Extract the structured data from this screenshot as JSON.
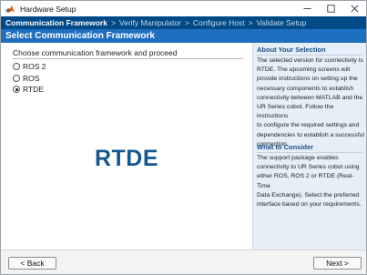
{
  "window": {
    "title": "Hardware Setup",
    "icon": "matlab-logo-icon",
    "controls": [
      "minimize-icon",
      "maximize-icon",
      "close-icon"
    ]
  },
  "breadcrumb": {
    "steps": [
      "Communication Framework",
      "Verify Manipulator",
      "Configure Host",
      "Validate Setup"
    ],
    "active_index": 0,
    "separator": ">"
  },
  "page": {
    "title": "Select Communication Framework"
  },
  "main": {
    "instruction": "Choose communication framework and proceed",
    "options": [
      {
        "label": "ROS 2",
        "checked": false
      },
      {
        "label": "ROS",
        "checked": false
      },
      {
        "label": "RTDE",
        "checked": true
      }
    ],
    "selected_display": "RTDE"
  },
  "side": {
    "about_heading": "About Your Selection",
    "about_lines": [
      "The selected version for connectivity is",
      "RTDE. The upcoming screens will",
      "provide instructions on setting up the",
      "necessary components to establish",
      "connectivity between MATLAB and the",
      "UR Series cobot. Follow the instructions",
      "to configure the required settings and",
      "dependencies to establish a successful",
      "connection."
    ],
    "consider_heading": "What to Consider",
    "consider_lines": [
      "The support package enables",
      "connectivity to UR Series cobot using",
      "either ROS, ROS 2 or RTDE (Real-Time",
      "Data Exchange). Select the preferred",
      "interface based on your requirements."
    ]
  },
  "footer": {
    "back_label": "< Back",
    "next_label": "Next >"
  },
  "colors": {
    "breadcrumb_bg": "#004a87",
    "title_bar_bg": "#1f6fc1",
    "side_bg": "#e6eef7",
    "accent_text": "#16578f"
  }
}
